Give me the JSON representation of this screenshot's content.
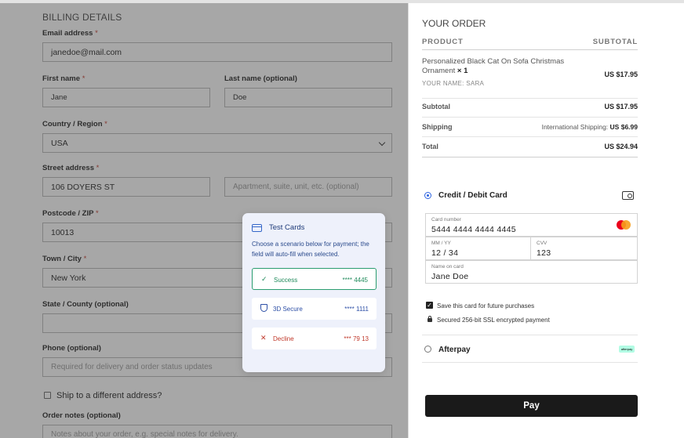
{
  "billing": {
    "title": "BILLING DETAILS",
    "email": {
      "label": "Email address",
      "value": "janedoe@mail.com"
    },
    "first_name": {
      "label": "First name",
      "value": "Jane"
    },
    "last_name": {
      "label": "Last name (optional)",
      "value": "Doe"
    },
    "country": {
      "label": "Country / Region",
      "value": "USA"
    },
    "street": {
      "label": "Street address",
      "value": "106 DOYERS ST",
      "apt_placeholder": "Apartment, suite, unit, etc. (optional)"
    },
    "postcode": {
      "label": "Postcode / ZIP",
      "value": "10013"
    },
    "city": {
      "label": "Town / City",
      "value": "New York"
    },
    "state": {
      "label": "State / County (optional)",
      "value": ""
    },
    "phone": {
      "label": "Phone (optional)",
      "placeholder": "Required for delivery and order status updates"
    },
    "ship_different": "Ship to a different address?",
    "notes": {
      "label": "Order notes (optional)",
      "placeholder": "Notes about your order, e.g. special notes for delivery."
    },
    "required_mark": "*"
  },
  "order": {
    "title": "YOUR ORDER",
    "col_product": "PRODUCT",
    "col_subtotal": "SUBTOTAL",
    "product": {
      "name": "Personalized Black Cat On Sofa Christmas Ornament",
      "qty": "× 1",
      "meta": "YOUR NAME: SARA",
      "price": "US $17.95"
    },
    "subtotal": {
      "label": "Subtotal",
      "value": "US $17.95"
    },
    "shipping": {
      "label": "Shipping",
      "method": "International Shipping:",
      "value": "US $6.99"
    },
    "total": {
      "label": "Total",
      "value": "US $24.94"
    }
  },
  "payment": {
    "card_method": "Credit / Debit Card",
    "card_number": {
      "label": "Card number",
      "value": "5444 4444 4444 4445"
    },
    "expiry": {
      "label": "MM / YY",
      "value": "12 / 34"
    },
    "cvv": {
      "label": "CVV",
      "value": "123"
    },
    "name": {
      "label": "Name on card",
      "value": "Jane Doe"
    },
    "save_card": "Save this card for future purchases",
    "secured": "Secured 256-bit SSL encrypted payment",
    "afterpay": "Afterpay",
    "afterpay_badge": "afterpay",
    "pay_button": "Pay"
  },
  "test_cards": {
    "title": "Test Cards",
    "description": "Choose a scenario below for payment; the field will auto-fill when selected.",
    "options": [
      {
        "name": "Success",
        "number": "**** 4445",
        "icon": "check-icon"
      },
      {
        "name": "3D Secure",
        "number": "**** 1111",
        "icon": "shield-icon"
      },
      {
        "name": "Decline",
        "number": "*** 79 13",
        "icon": "x-icon"
      }
    ]
  },
  "colors": {
    "accent": "#2d63e0",
    "success": "#1f8a5b",
    "decline": "#c0392b",
    "pay_button": "#1a1a1a"
  }
}
